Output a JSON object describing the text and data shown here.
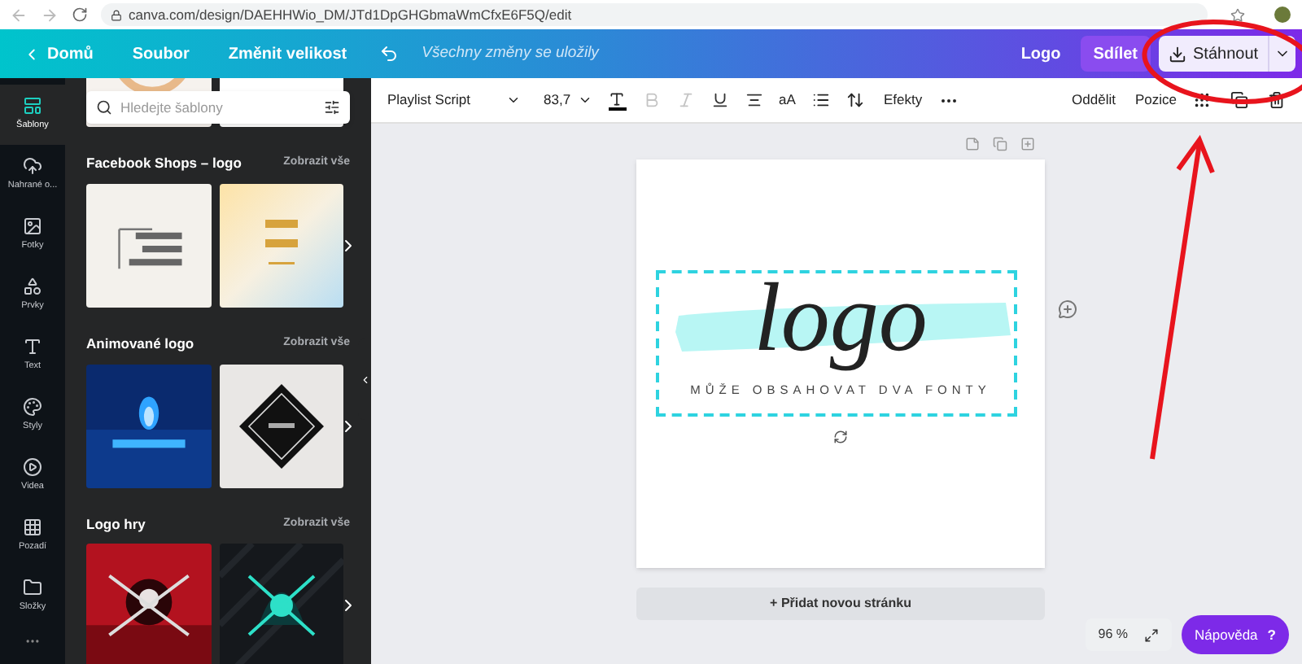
{
  "browser": {
    "url": "canva.com/design/DAEHHWio_DM/JTd1DpGHGbmaWmCfxE6F5Q/edit"
  },
  "topbar": {
    "home": "Domů",
    "menu": [
      "Soubor",
      "Změnit velikost"
    ],
    "status": "Všechny změny se uložily",
    "title": "Logo",
    "share": "Sdílet",
    "download": "Stáhnout"
  },
  "rail": [
    {
      "label": "Šablony",
      "selected": true
    },
    {
      "label": "Nahrané o...",
      "selected": false
    },
    {
      "label": "Fotky",
      "selected": false
    },
    {
      "label": "Prvky",
      "selected": false
    },
    {
      "label": "Text",
      "selected": false
    },
    {
      "label": "Styly",
      "selected": false
    },
    {
      "label": "Videa",
      "selected": false
    },
    {
      "label": "Pozadí",
      "selected": false
    },
    {
      "label": "Složky",
      "selected": false
    }
  ],
  "panel": {
    "search_placeholder": "Hledejte šablony",
    "sections": [
      {
        "title": "Facebook Shops – logo",
        "link": "Zobrazit vše"
      },
      {
        "title": "Animované logo",
        "link": "Zobrazit vše"
      },
      {
        "title": "Logo hry",
        "link": "Zobrazit vše"
      }
    ]
  },
  "toolbar": {
    "font": "Playlist Script",
    "size": "83,7",
    "format_buttons": [
      {
        "kind": "bold",
        "disabled": true
      },
      {
        "kind": "italic",
        "disabled": true
      },
      {
        "kind": "underline",
        "disabled": false
      },
      {
        "kind": "align",
        "disabled": false
      }
    ],
    "case": "aA",
    "effects": "Efekty",
    "split": "Oddělit",
    "position": "Pozice"
  },
  "canvas": {
    "headline": "logo",
    "tagline": "MŮŽE OBSAHOVAT DVA FONTY",
    "add_page": "+ Přidat novou stránku"
  },
  "footer": {
    "zoom": "96 %",
    "help": "Nápověda",
    "help_icon": "?"
  }
}
